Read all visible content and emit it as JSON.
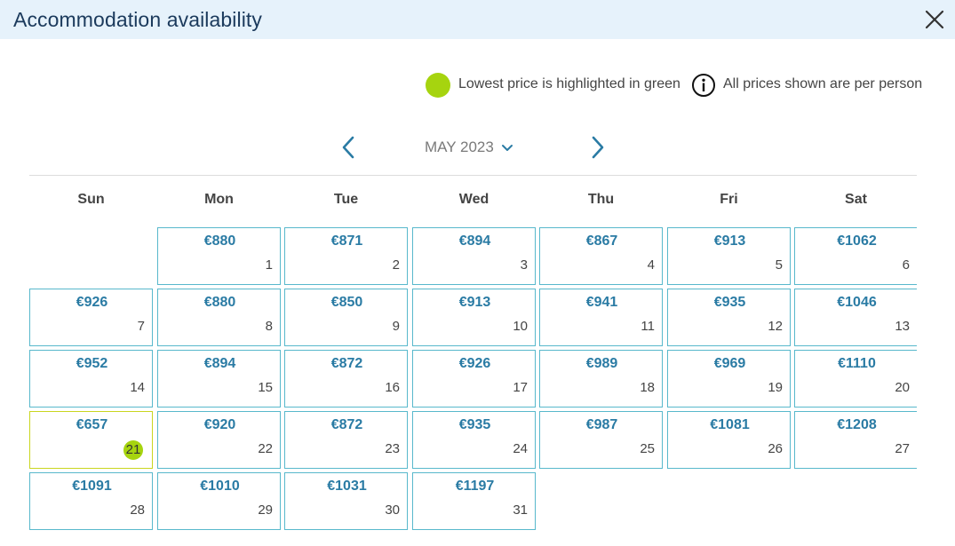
{
  "header": {
    "title": "Accommodation availability"
  },
  "legend": {
    "lowest_text": "Lowest price is highlighted in green",
    "per_person_text": "All prices shown are per person",
    "green_color": "#a6d40f"
  },
  "calendar": {
    "month_label": "MAY 2023",
    "weekdays": [
      "Sun",
      "Mon",
      "Tue",
      "Wed",
      "Thu",
      "Fri",
      "Sat"
    ],
    "first_weekday_index": 1,
    "days": [
      {
        "day": "1",
        "price": "€880"
      },
      {
        "day": "2",
        "price": "€871"
      },
      {
        "day": "3",
        "price": "€894"
      },
      {
        "day": "4",
        "price": "€867"
      },
      {
        "day": "5",
        "price": "€913"
      },
      {
        "day": "6",
        "price": "€1062"
      },
      {
        "day": "7",
        "price": "€926"
      },
      {
        "day": "8",
        "price": "€880"
      },
      {
        "day": "9",
        "price": "€850"
      },
      {
        "day": "10",
        "price": "€913"
      },
      {
        "day": "11",
        "price": "€941"
      },
      {
        "day": "12",
        "price": "€935"
      },
      {
        "day": "13",
        "price": "€1046"
      },
      {
        "day": "14",
        "price": "€952"
      },
      {
        "day": "15",
        "price": "€894"
      },
      {
        "day": "16",
        "price": "€872"
      },
      {
        "day": "17",
        "price": "€926"
      },
      {
        "day": "18",
        "price": "€989"
      },
      {
        "day": "19",
        "price": "€969"
      },
      {
        "day": "20",
        "price": "€1110"
      },
      {
        "day": "21",
        "price": "€657",
        "lowest": true
      },
      {
        "day": "22",
        "price": "€920"
      },
      {
        "day": "23",
        "price": "€872"
      },
      {
        "day": "24",
        "price": "€935"
      },
      {
        "day": "25",
        "price": "€987"
      },
      {
        "day": "26",
        "price": "€1081"
      },
      {
        "day": "27",
        "price": "€1208"
      },
      {
        "day": "28",
        "price": "€1091"
      },
      {
        "day": "29",
        "price": "€1010"
      },
      {
        "day": "30",
        "price": "€1031"
      },
      {
        "day": "31",
        "price": "€1197"
      }
    ]
  },
  "icons": {
    "close": "close-icon",
    "info": "info-icon",
    "prev": "chevron-left-icon",
    "next": "chevron-right-icon",
    "month_dropdown": "chevron-down-icon"
  },
  "colors": {
    "title_bar_bg": "#e6f2fb",
    "cell_border": "#58b8cc",
    "price_text": "#2a7ba4",
    "nav_arrow": "#2a7ba4"
  }
}
